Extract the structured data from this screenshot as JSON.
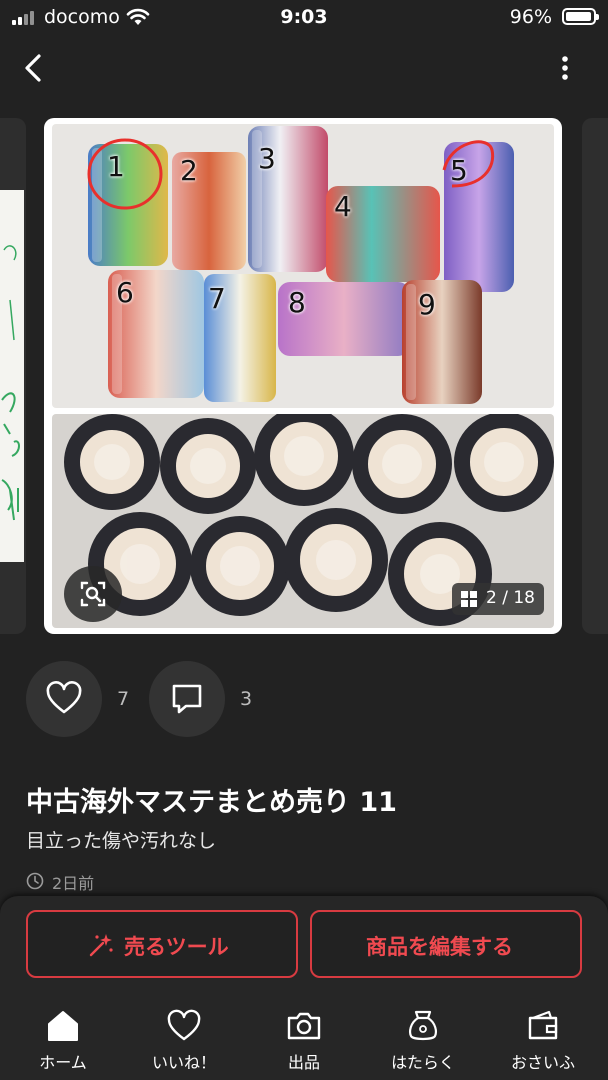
{
  "status_bar": {
    "carrier": "docomo",
    "time": "9:03",
    "battery": "96%"
  },
  "gallery": {
    "counter": "2 / 18",
    "tape_numbers": [
      "1",
      "2",
      "3",
      "4",
      "5",
      "6",
      "7",
      "8",
      "9"
    ]
  },
  "reactions": {
    "likes": "7",
    "comments": "3"
  },
  "item": {
    "title": "中古海外マステまとめ売り 11",
    "subtitle": "目立った傷や汚れなし",
    "posted": "2日前"
  },
  "actions": {
    "sell_tools": "売るツール",
    "edit_item": "商品を編集する"
  },
  "tab_bar": [
    {
      "label": "ホーム",
      "icon": "home-icon",
      "active": true
    },
    {
      "label": "いいね！",
      "icon": "heart-icon"
    },
    {
      "label": "出品",
      "icon": "camera-icon"
    },
    {
      "label": "はたらく",
      "icon": "money-bag-icon"
    },
    {
      "label": "おさいふ",
      "icon": "wallet-icon"
    }
  ],
  "colors": {
    "background": "#222222",
    "accent": "#d83b41",
    "annotation": "#e8302c"
  }
}
